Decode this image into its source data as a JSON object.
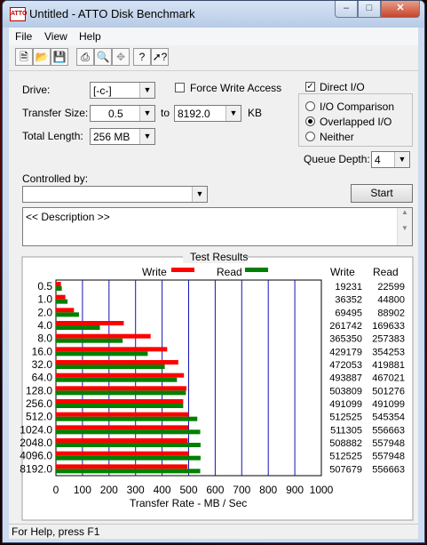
{
  "window": {
    "title": "Untitled - ATTO Disk Benchmark",
    "min": "–",
    "max": "□",
    "close": "✕"
  },
  "menu": [
    "File",
    "View",
    "Help"
  ],
  "toolbar": [
    "new-icon",
    "open-icon",
    "save-icon",
    "print-icon",
    "print-preview-icon",
    "move-icon",
    "help-icon",
    "context-help-icon"
  ],
  "form": {
    "drive_label": "Drive:",
    "drive_value": "[-c-]",
    "force_write_label": "Force Write Access",
    "transfer_label": "Transfer Size:",
    "transfer_from": "0.5",
    "to_label": "to",
    "transfer_to": "8192.0",
    "kb_label": "KB",
    "length_label": "Total Length:",
    "length_value": "256 MB",
    "direct_io_label": "Direct I/O",
    "io_comparison": "I/O Comparison",
    "overlapped_io": "Overlapped I/O",
    "neither": "Neither",
    "queue_depth_label": "Queue Depth:",
    "queue_depth_value": "4",
    "controlled_by_label": "Controlled by:",
    "start_label": "Start",
    "description": "<< Description >>"
  },
  "results": {
    "title": "Test Results",
    "write_legend": "Write",
    "read_legend": "Read",
    "write_col": "Write",
    "read_col": "Read",
    "write_color": "#ff0000",
    "read_color": "#008000",
    "xlabel": "Transfer Rate - MB / Sec"
  },
  "chart_data": {
    "type": "bar",
    "orientation": "horizontal",
    "categories": [
      "0.5",
      "1.0",
      "2.0",
      "4.0",
      "8.0",
      "16.0",
      "32.0",
      "64.0",
      "128.0",
      "256.0",
      "512.0",
      "1024.0",
      "2048.0",
      "4096.0",
      "8192.0"
    ],
    "series": [
      {
        "name": "Write",
        "values": [
          19231,
          36352,
          69495,
          261742,
          365350,
          429179,
          472053,
          493887,
          503809,
          491099,
          512525,
          511305,
          508882,
          512525,
          507679
        ]
      },
      {
        "name": "Read",
        "values": [
          22599,
          44800,
          88902,
          169633,
          257383,
          354253,
          419881,
          467021,
          501276,
          491099,
          545354,
          556663,
          557948,
          557948,
          556663
        ]
      }
    ],
    "xlabel": "Transfer Rate - MB / Sec",
    "xlim": [
      0,
      1000
    ],
    "xticks": [
      "0",
      "100",
      "200",
      "300",
      "400",
      "500",
      "600",
      "700",
      "800",
      "900",
      "1000"
    ]
  },
  "status": "For Help, press F1"
}
